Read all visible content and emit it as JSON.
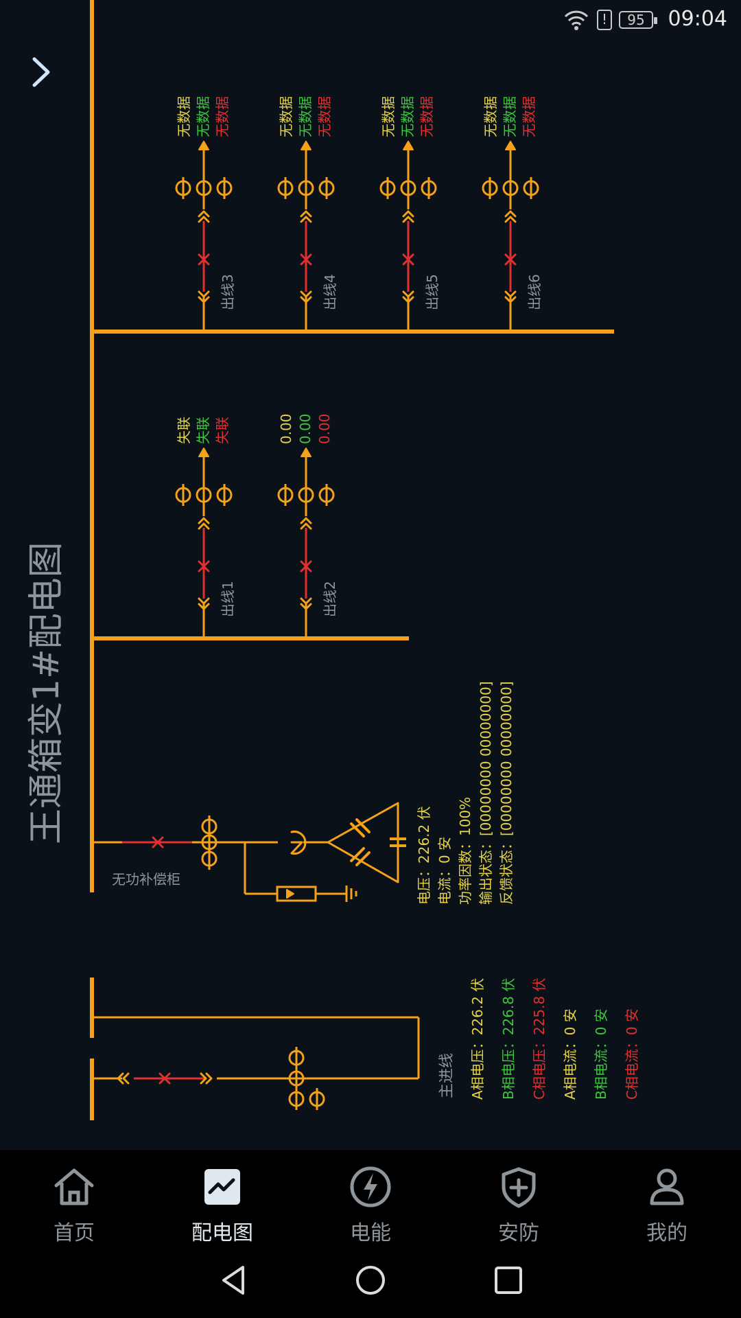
{
  "status": {
    "time": "09:04",
    "battery": "95"
  },
  "title": "王通箱变1#配电图",
  "diagram": {
    "feeders_top": [
      {
        "label": "出线3",
        "readings": [
          "无数据",
          "无数据",
          "无数据"
        ]
      },
      {
        "label": "出线4",
        "readings": [
          "无数据",
          "无数据",
          "无数据"
        ]
      },
      {
        "label": "出线5",
        "readings": [
          "无数据",
          "无数据",
          "无数据"
        ]
      },
      {
        "label": "出线6",
        "readings": [
          "无数据",
          "无数据",
          "无数据"
        ]
      }
    ],
    "feeders_mid": [
      {
        "label": "出线1",
        "readings": [
          "失联",
          "失联",
          "失联"
        ]
      },
      {
        "label": "出线2",
        "readings": [
          "0.00",
          "0.00",
          "0.00"
        ]
      }
    ],
    "compensation": {
      "label": "无功补偿柜",
      "info": [
        "电压：226.2 伏",
        "电流：0 安",
        "功率因数：100%",
        "输出状态：[00000000 00000000]",
        "反馈状态：[00000000 00000000]"
      ]
    },
    "main_incoming": {
      "label": "主进线",
      "readings": [
        "A相电压：226.2 伏",
        "B相电压：226.8 伏",
        "C相电压：225.8 伏",
        "A相电流：0 安",
        "B相电流：0 安",
        "C相电流：0 安"
      ]
    },
    "colors": {
      "bus": "#f5a21b",
      "phase_a": "#e4d24a",
      "phase_b": "#3ec53e",
      "phase_c": "#e03030",
      "label_gray": "#8e959b"
    }
  },
  "nav": {
    "items": [
      {
        "label": "首页",
        "icon": "home-icon"
      },
      {
        "label": "配电图",
        "icon": "chart-icon"
      },
      {
        "label": "电能",
        "icon": "lightning-icon"
      },
      {
        "label": "安防",
        "icon": "shield-icon"
      },
      {
        "label": "我的",
        "icon": "user-icon"
      }
    ],
    "active": 1
  }
}
